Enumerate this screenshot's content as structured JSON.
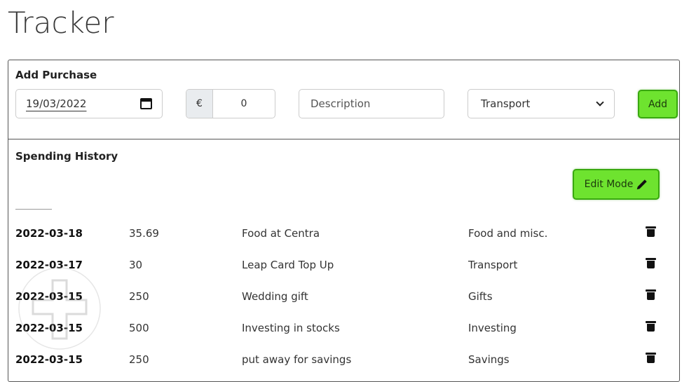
{
  "page": {
    "title": "Tracker"
  },
  "add_purchase": {
    "heading": "Add Purchase",
    "date_value": "19/03/2022",
    "currency_prefix": "€",
    "amount_value": "0",
    "description_placeholder": "Description",
    "category_selected": "Transport",
    "add_label": "Add"
  },
  "history": {
    "heading": "Spending History",
    "edit_mode_label": "Edit Mode",
    "rows": [
      {
        "date": "2022-03-18",
        "amount": "35.69",
        "description": "Food at Centra",
        "category": "Food and misc."
      },
      {
        "date": "2022-03-17",
        "amount": "30",
        "description": "Leap Card Top Up",
        "category": "Transport"
      },
      {
        "date": "2022-03-15",
        "amount": "250",
        "description": "Wedding gift",
        "category": "Gifts"
      },
      {
        "date": "2022-03-15",
        "amount": "500",
        "description": "Investing in stocks",
        "category": "Investing"
      },
      {
        "date": "2022-03-15",
        "amount": "250",
        "description": "put away for savings",
        "category": "Savings"
      }
    ]
  },
  "icons": {
    "calendar": "calendar-icon",
    "chevron": "chevron-down-icon",
    "pencil": "pencil-icon",
    "trash": "trash-icon"
  },
  "colors": {
    "button_green": "#6ee32f",
    "button_border": "#39a80f",
    "card_border": "#555555"
  }
}
